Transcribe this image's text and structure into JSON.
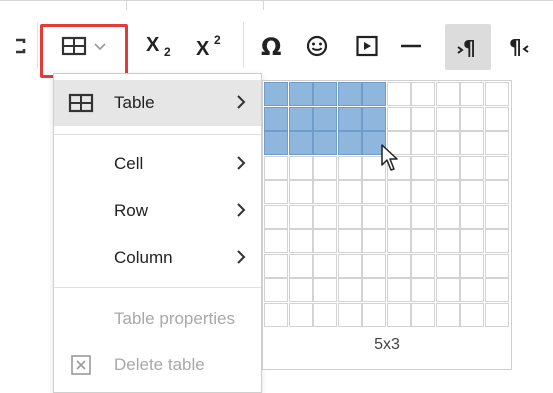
{
  "toolbar": {
    "buttons": [
      {
        "name": "fullscreen-icon"
      },
      {
        "name": "insert-table-icon"
      },
      {
        "name": "subscript-icon",
        "label": "X",
        "sub": "2"
      },
      {
        "name": "superscript-icon",
        "label": "X",
        "sup": "2"
      },
      {
        "name": "special-character-icon",
        "label": "Ω"
      },
      {
        "name": "emoji-icon"
      },
      {
        "name": "media-icon"
      },
      {
        "name": "horizontal-line-icon"
      },
      {
        "name": "ltr-icon",
        "label": "¶"
      },
      {
        "name": "rtl-icon",
        "label": "¶"
      }
    ],
    "highlight_color": "#e33a3a"
  },
  "menu": {
    "items": [
      {
        "label": "Table",
        "icon": "table-icon",
        "submenu": true,
        "active": true
      },
      {
        "label": "Cell",
        "submenu": true
      },
      {
        "label": "Row",
        "submenu": true
      },
      {
        "label": "Column",
        "submenu": true
      },
      {
        "label": "Table properties",
        "disabled": true
      },
      {
        "label": "Delete table",
        "icon": "delete-table-icon",
        "disabled": true
      }
    ]
  },
  "grid_picker": {
    "columns": 10,
    "rows": 10,
    "selected_cols": 5,
    "selected_rows": 3,
    "size_label": "5x3",
    "selected_color": "#8fb6dc"
  }
}
